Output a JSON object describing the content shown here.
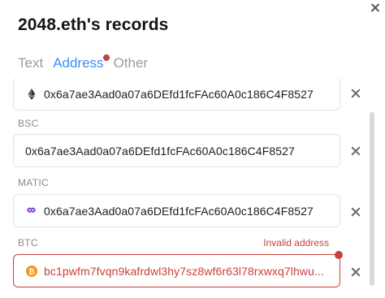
{
  "dialog": {
    "title": "2048.eth's records"
  },
  "tabs": [
    {
      "label": "Text",
      "active": false
    },
    {
      "label": "Address",
      "active": true,
      "has_error_dot": true
    },
    {
      "label": "Other",
      "active": false
    }
  ],
  "records": [
    {
      "label": "",
      "icon": "ethereum-icon",
      "value": "0x6a7ae3Aad0a07a6DEfd1fcFAc60A0c186C4F8527",
      "error": false
    },
    {
      "label": "BSC",
      "icon": "",
      "value": "0x6a7ae3Aad0a07a6DEfd1fcFAc60A0c186C4F8527",
      "error": false
    },
    {
      "label": "MATIC",
      "icon": "polygon-icon",
      "value": "0x6a7ae3Aad0a07a6DEfd1fcFAc60A0c186C4F8527",
      "error": false
    },
    {
      "label": "BTC",
      "icon": "bitcoin-icon",
      "value": "bc1pwfm7fvqn9kafrdwl3hy7sz8wf6r63l78rxwxq7lhwu...",
      "error": true,
      "error_text": "Invalid address"
    }
  ],
  "colors": {
    "accent": "#3d8ef0",
    "error": "#c8403b",
    "polygon": "#8247e5",
    "bitcoin": "#f7931a"
  }
}
